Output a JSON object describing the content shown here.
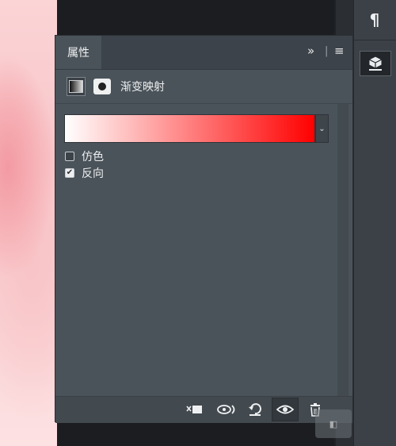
{
  "panel": {
    "tab_label": "属性",
    "expand_glyph": "»",
    "menu_glyph": "≡",
    "adjustment_title": "渐变映射",
    "gradient": {
      "start_color": "#ffffff",
      "end_color": "#ff0000"
    },
    "options": [
      {
        "label": "仿色",
        "checked": false
      },
      {
        "label": "反向",
        "checked": true
      }
    ]
  },
  "right_toolbar": {
    "icons": [
      "paragraph-icon",
      "3d-cube-icon"
    ],
    "paragraph_glyph": "¶"
  },
  "footer": {
    "buttons": [
      "clip-to-layer-icon",
      "view-previous-state-icon",
      "reset-icon",
      "visibility-eye-icon",
      "delete-icon"
    ]
  }
}
